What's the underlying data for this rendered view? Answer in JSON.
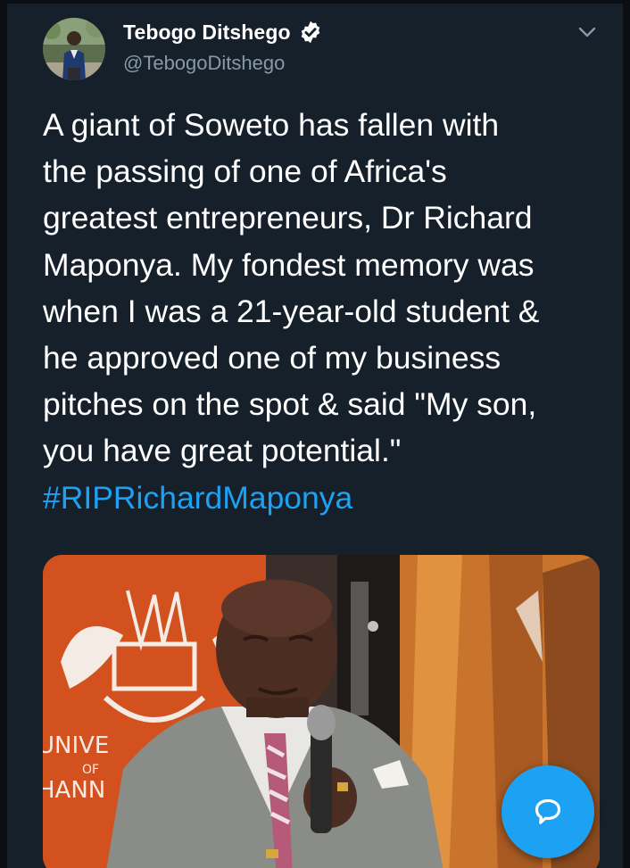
{
  "tweet": {
    "author": {
      "display_name": "Tebogo Ditshego",
      "handle": "@TebogoDitshego",
      "verified": true
    },
    "text_lines": [
      "A giant of Soweto has fallen with",
      "the passing of one of Africa's",
      "greatest entrepreneurs, Dr Richard",
      "Maponya. My fondest memory was",
      "when I was a 21-year-old student &",
      "he approved one of my business",
      "pitches on the spot & said \"My son,",
      "you have great potential.\""
    ],
    "hashtag": "#RIPRichardMaponya",
    "media": {
      "banner_text_lines": [
        "UNIVE",
        "OF",
        "HANN"
      ]
    }
  },
  "icons": {
    "avatar": "avatar-photo",
    "verified": "verified-badge-icon",
    "menu": "chevron-down-icon",
    "fab": "compose-reply-icon"
  },
  "colors": {
    "background": "#15202b",
    "accent": "#1da1f2",
    "secondary_text": "#8899a6"
  }
}
